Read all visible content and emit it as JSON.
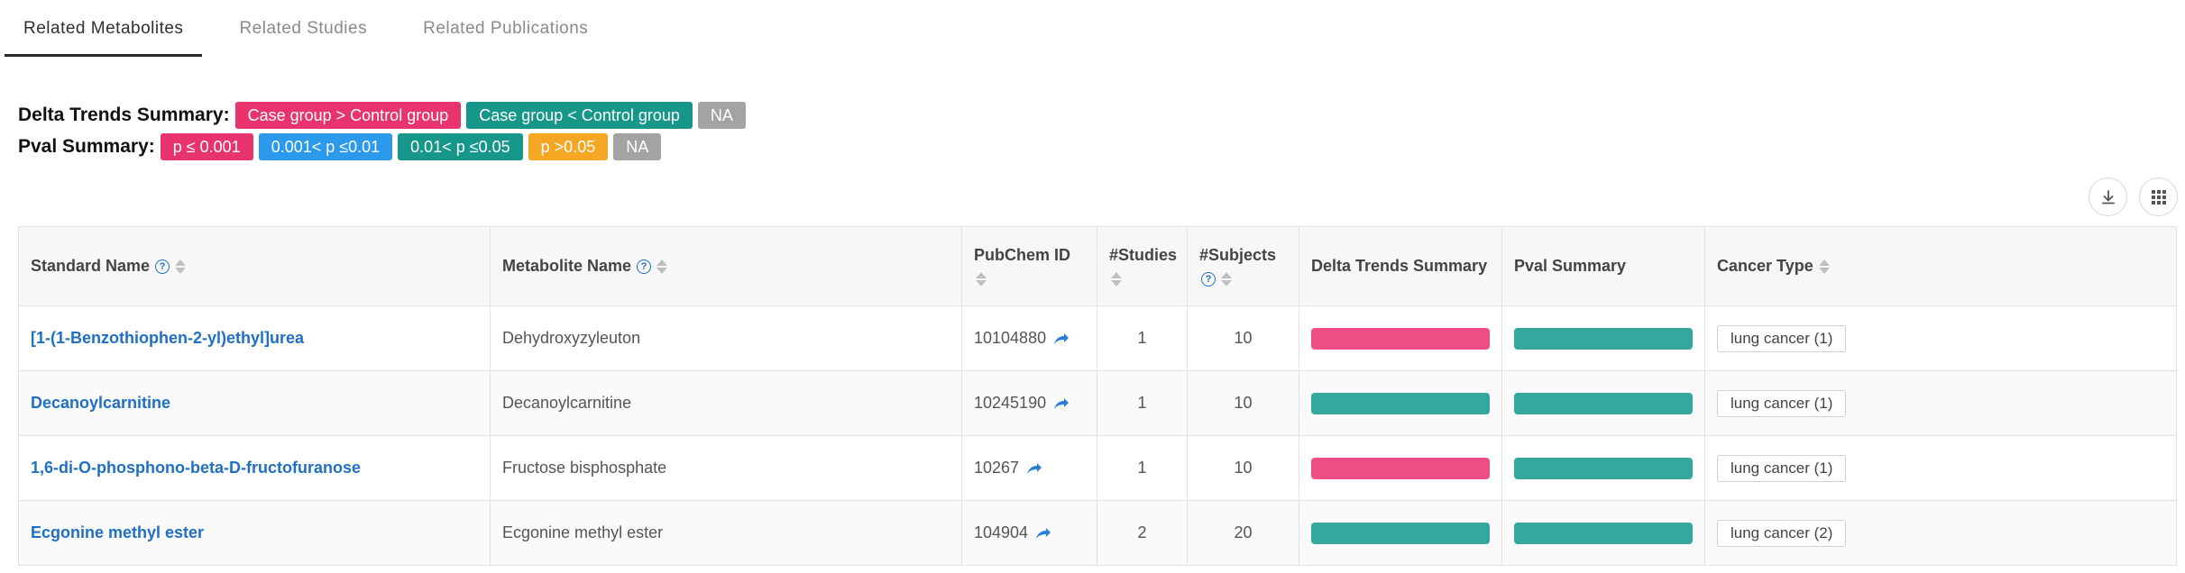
{
  "tabs": [
    {
      "label": "Related Metabolites",
      "active": true
    },
    {
      "label": "Related Studies",
      "active": false
    },
    {
      "label": "Related Publications",
      "active": false
    }
  ],
  "delta_summary": {
    "label": "Delta Trends Summary:",
    "chips": [
      {
        "label": "Case group > Control group",
        "color": "#e8336d"
      },
      {
        "label": "Case group < Control group",
        "color": "#16978a"
      },
      {
        "label": "NA",
        "color": "#a3a3a3"
      }
    ]
  },
  "pval_summary": {
    "label": "Pval Summary:",
    "chips": [
      {
        "label": "p ≤ 0.001",
        "color": "#e8336d"
      },
      {
        "label": "0.001< p ≤0.01",
        "color": "#2b99ec"
      },
      {
        "label": "0.01< p ≤0.05",
        "color": "#16978a"
      },
      {
        "label": "p >0.05",
        "color": "#f5a623"
      },
      {
        "label": "NA",
        "color": "#a3a3a3"
      }
    ]
  },
  "toolbar": {
    "download_icon": "download-icon",
    "columns_icon": "grid-icon"
  },
  "table": {
    "headers": {
      "standard_name": "Standard Name",
      "metabolite_name": "Metabolite Name",
      "pubchem_id": "PubChem ID",
      "studies": "#Studies",
      "subjects": "#Subjects",
      "delta": "Delta Trends Summary",
      "pval": "Pval Summary",
      "cancer_type": "Cancer Type"
    },
    "rows": [
      {
        "standard_name": "[1-(1-Benzothiophen-2-yl)ethyl]urea",
        "metabolite_name": "Dehydroxyzyleuton",
        "pubchem_id": "10104880",
        "studies": "1",
        "subjects": "10",
        "delta_color": "#ec4f86",
        "pval_color": "#35a89e",
        "cancer_type": "lung cancer (1)"
      },
      {
        "standard_name": "Decanoylcarnitine",
        "metabolite_name": "Decanoylcarnitine",
        "pubchem_id": "10245190",
        "studies": "1",
        "subjects": "10",
        "delta_color": "#35a89e",
        "pval_color": "#35a89e",
        "cancer_type": "lung cancer (1)"
      },
      {
        "standard_name": "1,6-di-O-phosphono-beta-D-fructofuranose",
        "metabolite_name": "Fructose bisphosphate",
        "pubchem_id": "10267",
        "studies": "1",
        "subjects": "10",
        "delta_color": "#ec4f86",
        "pval_color": "#35a89e",
        "cancer_type": "lung cancer (1)"
      },
      {
        "standard_name": "Ecgonine methyl ester",
        "metabolite_name": "Ecgonine methyl ester",
        "pubchem_id": "104904",
        "studies": "2",
        "subjects": "20",
        "delta_color": "#35a89e",
        "pval_color": "#35a89e",
        "cancer_type": "lung cancer (2)"
      }
    ]
  }
}
